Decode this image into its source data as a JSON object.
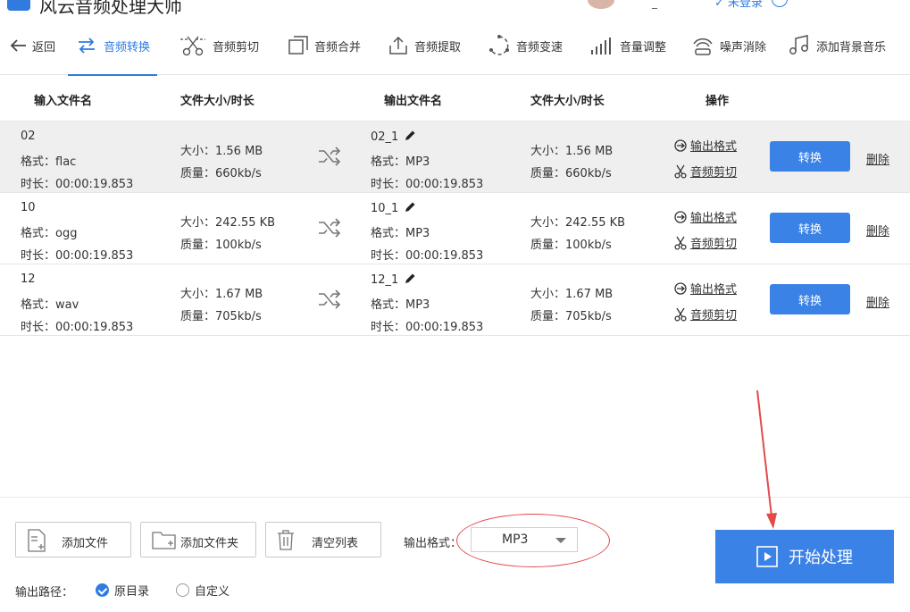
{
  "app": {
    "title": "风云音频处理大师"
  },
  "titlebar": {
    "dash": "_",
    "user": "✓ 未登录"
  },
  "toolbar": {
    "back": "返回",
    "tools": [
      {
        "label": "音频转换",
        "icon": "convert-icon"
      },
      {
        "label": "音频剪切",
        "icon": "scissors-icon"
      },
      {
        "label": "音频合并",
        "icon": "merge-icon"
      },
      {
        "label": "音频提取",
        "icon": "extract-icon"
      },
      {
        "label": "音频变速",
        "icon": "speed-icon"
      },
      {
        "label": "音量调整",
        "icon": "volume-icon"
      },
      {
        "label": "噪声消除",
        "icon": "noise-icon"
      },
      {
        "label": "添加背景音乐",
        "icon": "music-note-icon"
      }
    ]
  },
  "table": {
    "headers": {
      "input_name": "输入文件名",
      "input_size": "文件大小/时长",
      "output_name": "输出文件名",
      "output_size": "文件大小/时长",
      "actions": "操作"
    },
    "rows": [
      {
        "name": "02",
        "format": "格式：flac",
        "duration": "时长：00:00:19.853",
        "size": "大小：1.56 MB",
        "quality": "质量：660kb/s",
        "out_name": "02_1",
        "out_format": "格式：MP3",
        "out_duration": "时长：00:00:19.853",
        "out_size": "大小：1.56 MB",
        "out_quality": "质量：660kb/s",
        "op_format": "输出格式",
        "op_cut": "音频剪切",
        "convert": "转换",
        "delete": "删除"
      },
      {
        "name": "10",
        "format": "格式：ogg",
        "duration": "时长：00:00:19.853",
        "size": "大小：242.55 KB",
        "quality": "质量：100kb/s",
        "out_name": "10_1",
        "out_format": "格式：MP3",
        "out_duration": "时长：00:00:19.853",
        "out_size": "大小：242.55 KB",
        "out_quality": "质量：100kb/s",
        "op_format": "输出格式",
        "op_cut": "音频剪切",
        "convert": "转换",
        "delete": "删除"
      },
      {
        "name": "12",
        "format": "格式：wav",
        "duration": "时长：00:00:19.853",
        "size": "大小：1.67 MB",
        "quality": "质量：705kb/s",
        "out_name": "12_1",
        "out_format": "格式：MP3",
        "out_duration": "时长：00:00:19.853",
        "out_size": "大小：1.67 MB",
        "out_quality": "质量：705kb/s",
        "op_format": "输出格式",
        "op_cut": "音频剪切",
        "convert": "转换",
        "delete": "删除"
      }
    ]
  },
  "bottom": {
    "add_file": "添加文件",
    "add_folder": "添加文件夹",
    "clear_list": "清空列表",
    "output_format_label": "输出格式：",
    "output_format_value": "MP3",
    "start": "开始处理",
    "output_path_label": "输出路径：",
    "path_original": "原目录",
    "path_custom": "自定义"
  },
  "colors": {
    "accent": "#3b82e6",
    "annotation": "#e34a4a"
  }
}
